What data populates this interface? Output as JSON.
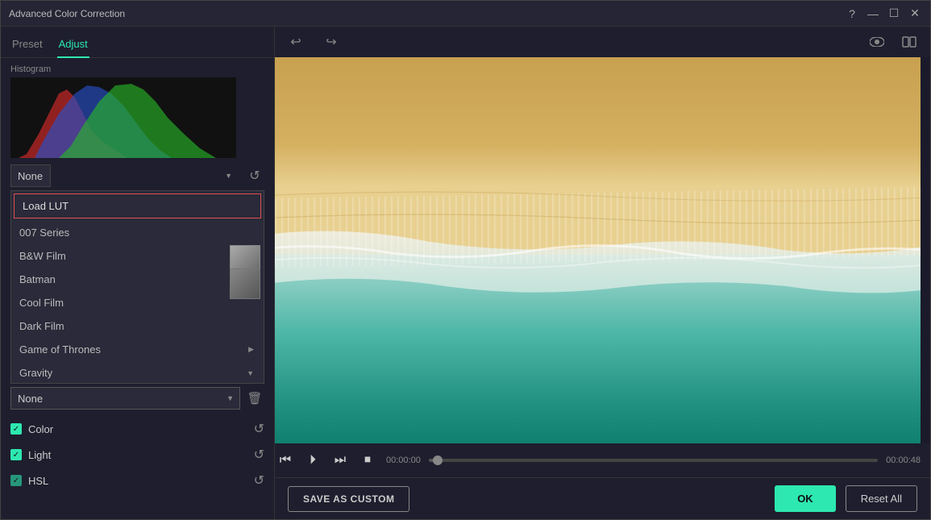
{
  "window": {
    "title": "Advanced Color Correction"
  },
  "tabs": {
    "preset": "Preset",
    "adjust": "Adjust",
    "active": "Adjust"
  },
  "histogram": {
    "label": "Histogram"
  },
  "lut_dropdown": {
    "selected": "None",
    "placeholder": "None"
  },
  "list_items": [
    {
      "id": "load-lut",
      "label": "Load LUT",
      "type": "load",
      "expanded": false
    },
    {
      "id": "007-series",
      "label": "007 Series",
      "type": "item",
      "has_children": false
    },
    {
      "id": "bw-film",
      "label": "B&W Film",
      "type": "item",
      "has_children": false
    },
    {
      "id": "batman",
      "label": "Batman",
      "type": "item",
      "has_children": false
    },
    {
      "id": "cool-film",
      "label": "Cool Film",
      "type": "item",
      "has_children": false
    },
    {
      "id": "dark-film",
      "label": "Dark Film",
      "type": "item",
      "has_children": false
    },
    {
      "id": "game-of-thrones",
      "label": "Game of Thrones",
      "type": "item",
      "has_children": true,
      "expanded": false
    },
    {
      "id": "gravity",
      "label": "Gravity",
      "type": "item",
      "has_children": true,
      "expanded": true
    }
  ],
  "none_select": {
    "value": "None",
    "options": [
      "None"
    ]
  },
  "adjustments": [
    {
      "id": "color",
      "label": "Color",
      "checked": true
    },
    {
      "id": "light",
      "label": "Light",
      "checked": true
    },
    {
      "id": "hsl",
      "label": "HSL",
      "checked": true
    }
  ],
  "toolbar": {
    "undo_label": "↩",
    "redo_label": "↪"
  },
  "playback": {
    "time_current": "00:00:00",
    "time_total": "00:00:48",
    "progress_pct": 2
  },
  "actions": {
    "save_custom": "SAVE AS CUSTOM",
    "ok": "OK",
    "reset_all": "Reset All"
  }
}
